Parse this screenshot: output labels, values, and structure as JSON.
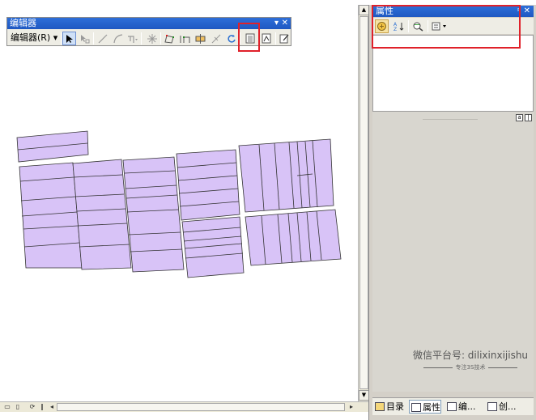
{
  "editor_toolbar": {
    "title": "编辑器",
    "menu_label": "编辑器(R)",
    "menu_arrow": "▾",
    "title_controls": [
      "▾",
      "✕"
    ],
    "tools": [
      "edit-tool-icon",
      "edit-annotation-icon",
      "straight-segment-icon",
      "end-point-arc-icon",
      "trace-icon",
      "point-icon",
      "edit-vertices-icon",
      "reshape-icon",
      "cut-polygon-icon",
      "split-icon",
      "rotate-icon",
      "attributes-icon",
      "sketch-properties-icon",
      "create-features-icon"
    ],
    "highlighted_tool": "attributes-icon"
  },
  "attributes_panel": {
    "title": "属性",
    "pin_glyph": "ᵖ",
    "close_glyph": "✕",
    "tools": [
      "show-layer-icon",
      "sort-az-icon",
      "identify-icon",
      "options-dropdown-icon"
    ],
    "highlight_color": "#e0212a"
  },
  "bottom_bar": {
    "icons": [
      "data-view-icon",
      "layout-view-icon",
      "refresh-icon",
      "pause-icon",
      "scroll-left-icon",
      "scroll-right-icon"
    ]
  },
  "panel_tabs": [
    {
      "label": "目录",
      "icon": "catalog-icon",
      "active": false
    },
    {
      "label": "属性",
      "icon": "attributes-tab-icon",
      "active": true
    },
    {
      "label": "编...",
      "icon": "edit-tab-icon",
      "active": false
    },
    {
      "label": "创...",
      "icon": "create-tab-icon",
      "active": false
    }
  ],
  "watermark": {
    "main": "微信平台号: dilixinxijishu",
    "sub": "专注3S技术"
  },
  "colors": {
    "parcel_fill": "#d8c3f7",
    "parcel_stroke": "#333333",
    "title_bar": "#1e58c2",
    "highlight_box": "#e0212a"
  }
}
